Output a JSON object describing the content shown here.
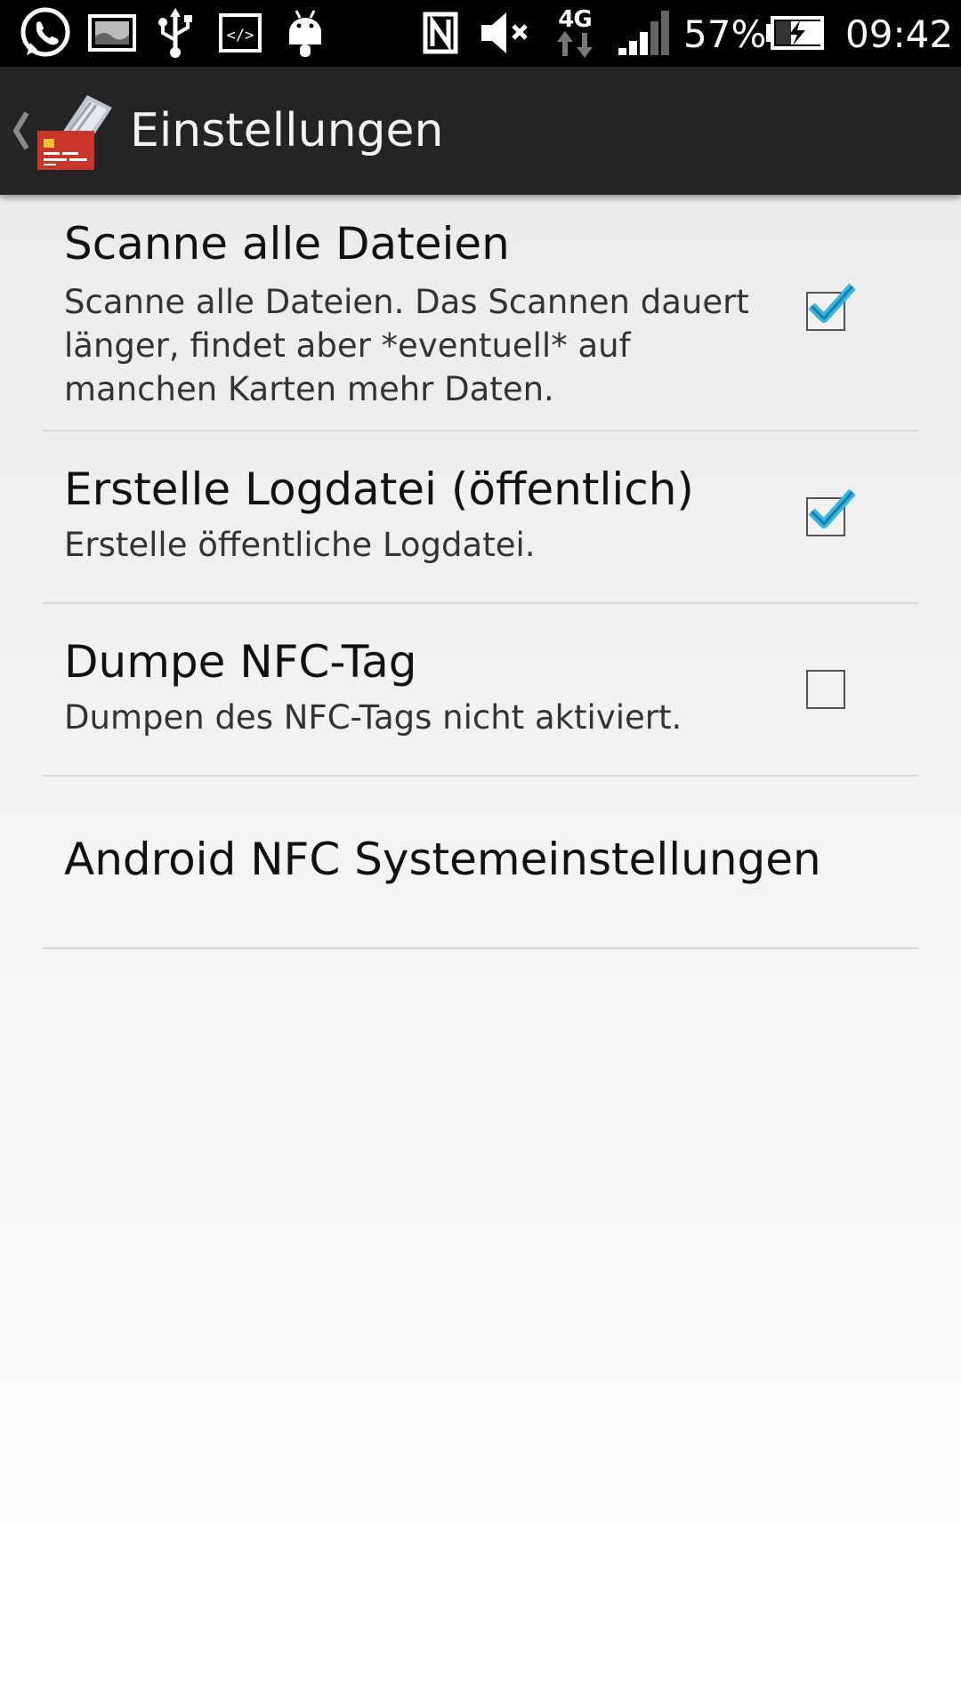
{
  "status_bar": {
    "icons": [
      "whatsapp-icon",
      "gallery-icon",
      "usb-icon",
      "developer-code-icon",
      "android-icon",
      "nfc-icon",
      "mute-icon",
      "network-4g-icon",
      "signal-icon",
      "battery-charging-icon"
    ],
    "network_label": "4G",
    "battery_percent": "57%",
    "time": "09:42"
  },
  "action_bar": {
    "title": "Einstellungen"
  },
  "preferences": [
    {
      "title": "Scanne alle Dateien",
      "summary": "Scanne alle Dateien. Das Scannen dauert länger, findet aber *eventuell* auf manchen Karten mehr Daten.",
      "checked": true
    },
    {
      "title": "Erstelle Logdatei (öffentlich)",
      "summary": "Erstelle öffentliche Logdatei.",
      "checked": true
    },
    {
      "title": "Dumpe NFC-Tag",
      "summary": "Dumpen des NFC-Tags nicht aktiviert.",
      "checked": false
    },
    {
      "title": "Android NFC Systemeinstellungen"
    }
  ],
  "colors": {
    "accent_check": "#33b5e5",
    "action_bar": "#242424",
    "status_bar": "#000000"
  }
}
